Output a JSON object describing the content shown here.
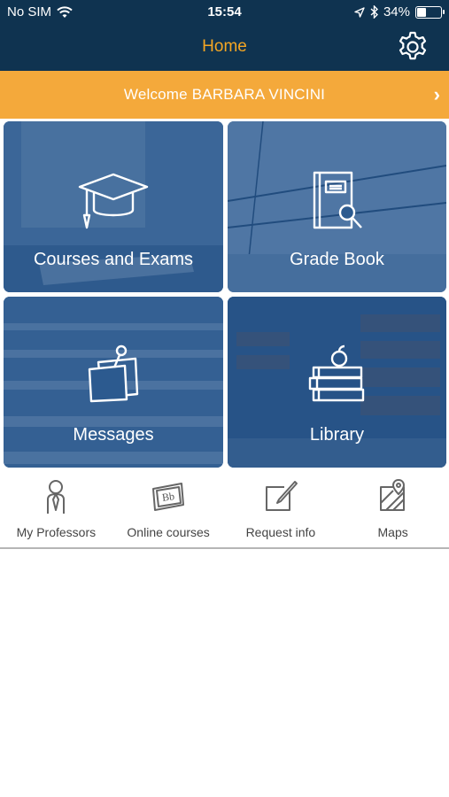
{
  "status_bar": {
    "carrier": "No SIM",
    "time": "15:54",
    "battery": "34%",
    "battery_level": 0.34,
    "icons": [
      "wifi-icon",
      "location-arrow-icon",
      "bluetooth-icon",
      "battery-icon"
    ]
  },
  "nav": {
    "title": "Home",
    "settings_icon": "gear-icon"
  },
  "welcome": {
    "text": "Welcome BARBARA VINCINI",
    "chevron": "›"
  },
  "tiles": [
    {
      "label": "Courses and Exams",
      "icon": "graduation-cap-icon"
    },
    {
      "label": "Grade Book",
      "icon": "gradebook-search-icon"
    },
    {
      "label": "Messages",
      "icon": "pinned-notes-icon"
    },
    {
      "label": "Library",
      "icon": "books-apple-icon"
    }
  ],
  "shortcuts": [
    {
      "label": "My Professors",
      "icon": "professor-icon"
    },
    {
      "label": "Online courses",
      "icon": "blackboard-bb-icon"
    },
    {
      "label": "Request info",
      "icon": "edit-note-icon"
    },
    {
      "label": "Maps",
      "icon": "map-icon"
    }
  ],
  "colors": {
    "nav_background": "#0f3350",
    "title_accent": "#f5a623",
    "welcome_background": "#f4a93b",
    "tile_overlay": "#1c4e87"
  }
}
